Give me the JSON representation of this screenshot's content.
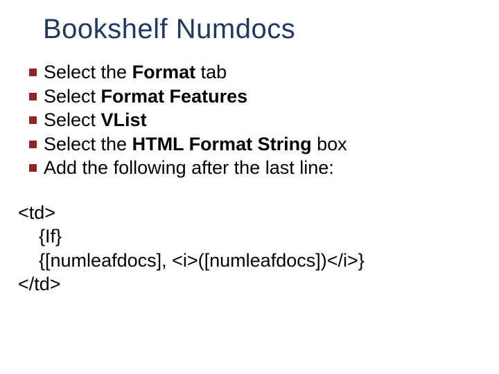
{
  "title": "Bookshelf Numdocs",
  "bullets": [
    {
      "pre": "Select the ",
      "bold": "Format",
      "post": " tab"
    },
    {
      "pre": "Select ",
      "bold": "Format Features",
      "post": ""
    },
    {
      "pre": "Select ",
      "bold": "VList",
      "post": ""
    },
    {
      "pre": "Select the ",
      "bold": "HTML Format String",
      "post": " box"
    },
    {
      "pre": "Add the following after the last line:",
      "bold": "",
      "post": ""
    }
  ],
  "code": {
    "l1": "<td>",
    "l2": "    {If}",
    "l3": "    {[numleafdocs], <i>([numleafdocs])</i>}",
    "l4": "</td>"
  }
}
